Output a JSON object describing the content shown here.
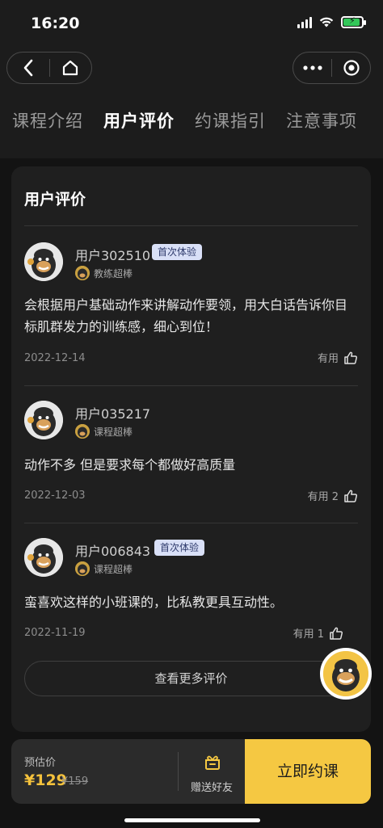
{
  "status_bar": {
    "time": "16:20"
  },
  "header": {
    "tabs": [
      {
        "label": "课程介绍",
        "active": false
      },
      {
        "label": "用户评价",
        "active": true
      },
      {
        "label": "约课指引",
        "active": false
      },
      {
        "label": "注意事项",
        "active": false
      }
    ]
  },
  "reviews_section": {
    "title": "用户评价",
    "reviews": [
      {
        "user": "用户302510",
        "badge": "首次体验",
        "tag": "教练超棒",
        "content": "会根据用户基础动作来讲解动作要领，用大白话告诉你目标肌群发力的训练感，细心到位！",
        "date": "2022-12-14",
        "useful": "有用"
      },
      {
        "user": "用户035217",
        "badge": "",
        "tag": "课程超棒",
        "content": "动作不多 但是要求每个都做好高质量",
        "date": "2022-12-03",
        "useful": "有用 2"
      },
      {
        "user": "用户006843",
        "badge": "首次体验",
        "tag": "课程超棒",
        "content": "蛮喜欢这样的小班课的，比私教更具互动性。",
        "date": "2022-11-19",
        "useful": "有用 1"
      }
    ],
    "more_button": "查看更多评价"
  },
  "bottom_bar": {
    "price_label": "预估价",
    "price": "¥129",
    "original_price": "¥159",
    "gift_label": "赠送好友",
    "buy_button": "立即约课"
  },
  "colors": {
    "accent": "#f5c842",
    "badge_bg": "#d9e0f7",
    "background": "#131313",
    "card": "#1f1f1f"
  },
  "icons": [
    "back-icon",
    "home-icon",
    "more-icon",
    "close-target-icon",
    "thumbs-up-icon",
    "gift-icon",
    "gorilla-avatar"
  ]
}
